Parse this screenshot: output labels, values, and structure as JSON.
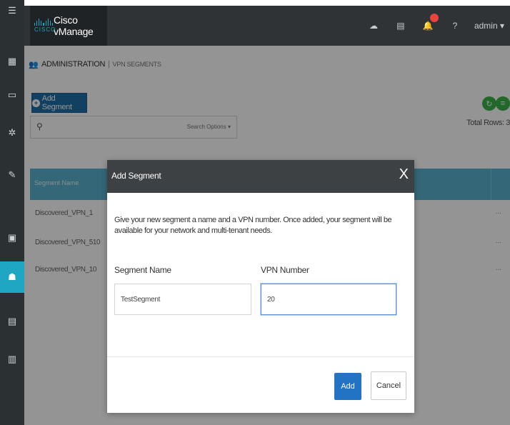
{
  "app": {
    "brand": "Cisco vManage",
    "logo_word": "CISCO",
    "user": "admin ▾"
  },
  "breadcrumb": {
    "section": "ADMINISTRATION",
    "separator": "|",
    "page": "VPN SEGMENTS"
  },
  "toolbar": {
    "add_segment_label": "Add Segment",
    "search_options_label": "Search Options ▾",
    "total_rows_label": "Total Rows: 3"
  },
  "table": {
    "columns": [
      "Segment Name"
    ],
    "rows": [
      {
        "name": "Discovered_VPN_1",
        "more": "..."
      },
      {
        "name": "Discovered_VPN_510",
        "more": "..."
      },
      {
        "name": "Discovered_VPN_10",
        "more": "..."
      }
    ]
  },
  "modal": {
    "title": "Add Segment",
    "close_label": "X",
    "description": "Give your new segment a name and a VPN number. Once added, your segment will be available for your network and multi-tenant needs.",
    "segment_name_label": "Segment Name",
    "segment_name_value": "TestSegment",
    "vpn_number_label": "VPN Number",
    "vpn_number_value": "20",
    "add_label": "Add",
    "cancel_label": "Cancel"
  },
  "colors": {
    "primary": "#2273c4",
    "accent": "#1ea6c2",
    "table_header": "#5ab3cf",
    "refresh_green": "#3cb44b"
  }
}
